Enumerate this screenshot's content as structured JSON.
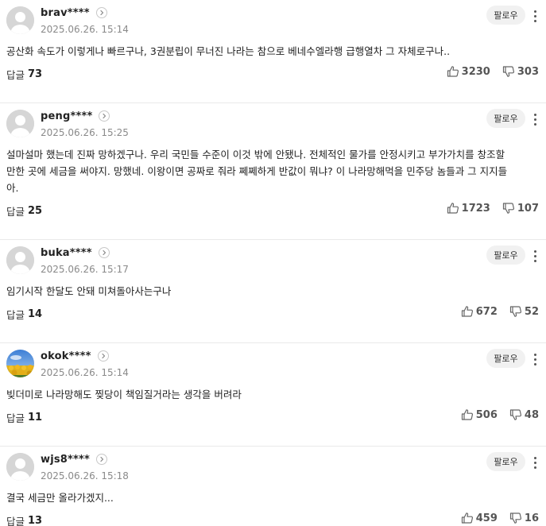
{
  "comments": [
    {
      "nickname": "brav****",
      "timestamp": "2025.06.26. 15:14",
      "follow_label": "팔로우",
      "text": "공산화 속도가 이렇게나 빠르구나, 3권분립이 무너진 나라는 참으로 베네수엘라행 급행열차 그 자체로구나..",
      "reply_label": "답글",
      "reply_count": "73",
      "likes": "3230",
      "dislikes": "303",
      "avatar": "default-avatar"
    },
    {
      "nickname": "peng****",
      "timestamp": "2025.06.26. 15:25",
      "follow_label": "팔로우",
      "text": "설마설마 했는데 진짜 망하겠구나. 우리 국민들 수준이 이것 밖에 안됐나. 전체적인 물가를 안정시키고 부가가치를 창조할 만한 곳에 세금을 써야지. 망했네. 이왕이면 공짜로 줘라 쩨쩨하게 반값이 뭐냐? 이 나라망해먹을 민주당 놈들과 그 지지들아.",
      "reply_label": "답글",
      "reply_count": "25",
      "likes": "1723",
      "dislikes": "107",
      "avatar": "default-avatar"
    },
    {
      "nickname": "buka****",
      "timestamp": "2025.06.26. 15:17",
      "follow_label": "팔로우",
      "text": "임기시작 한달도 안돼 미쳐돌아사는구나",
      "reply_label": "답글",
      "reply_count": "14",
      "likes": "672",
      "dislikes": "52",
      "avatar": "default-avatar"
    },
    {
      "nickname": "okok****",
      "timestamp": "2025.06.26. 15:14",
      "follow_label": "팔로우",
      "text": "빚더미로 나라망해도 찢당이 책임질거라는 생각을 버려라",
      "reply_label": "답글",
      "reply_count": "11",
      "likes": "506",
      "dislikes": "48",
      "avatar": "sunflower-photo-avatar"
    },
    {
      "nickname": "wjs8****",
      "timestamp": "2025.06.26. 15:18",
      "follow_label": "팔로우",
      "text": "결국 세금만 올라가겠지...",
      "reply_label": "답글",
      "reply_count": "13",
      "likes": "459",
      "dislikes": "16",
      "avatar": "default-avatar"
    }
  ],
  "icons": {
    "profile_link": "chevron-right-icon",
    "more": "more-vertical-icon",
    "like": "thumbs-up-icon",
    "dislike": "thumbs-down-icon"
  },
  "colors": {
    "text": "#222222",
    "meta": "#8a8a8a",
    "follow_bg": "#f1f1f1",
    "divider": "#e9e9e9",
    "avatar_default": "#d5d5d5"
  }
}
